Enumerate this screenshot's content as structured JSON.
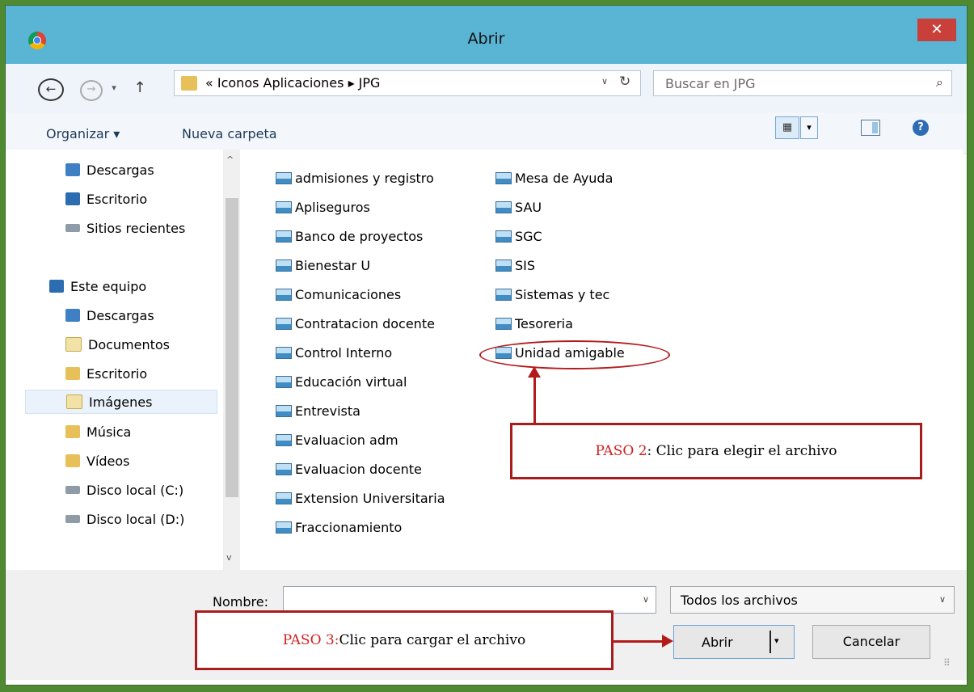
{
  "window": {
    "title": "Abrir",
    "close_label": "✕"
  },
  "nav": {
    "back": "←",
    "forward": "→",
    "history": "▾",
    "up": "↑"
  },
  "address": {
    "path": "« Iconos Aplicaciones ▸ JPG",
    "dropdown": "∨",
    "refresh": "↻"
  },
  "search": {
    "placeholder": "Buscar en JPG",
    "icon": "⌕"
  },
  "toolbar": {
    "organize": "Organizar ▾",
    "new_folder": "Nueva carpeta",
    "view_icon": "▦",
    "view_dropdown": "▾",
    "help": "?"
  },
  "sidebar": {
    "items": [
      {
        "label": "Descargas",
        "icon": "downloads-folder-icon"
      },
      {
        "label": "Escritorio",
        "icon": "desktop-icon"
      },
      {
        "label": "Sitios recientes",
        "icon": "recent-places-icon"
      },
      {
        "label": "Este equipo",
        "icon": "computer-icon"
      },
      {
        "label": "Descargas",
        "icon": "downloads-folder-icon"
      },
      {
        "label": "Documentos",
        "icon": "documents-folder-icon"
      },
      {
        "label": "Escritorio",
        "icon": "desktop-folder-icon"
      },
      {
        "label": "Imágenes",
        "icon": "pictures-folder-icon",
        "selected": true
      },
      {
        "label": "Música",
        "icon": "music-folder-icon"
      },
      {
        "label": "Vídeos",
        "icon": "videos-folder-icon"
      },
      {
        "label": "Disco local (C:)",
        "icon": "drive-c-icon"
      },
      {
        "label": "Disco local (D:)",
        "icon": "drive-d-icon"
      }
    ],
    "scroll_up": "^",
    "scroll_down": "v"
  },
  "files": {
    "col1": [
      "admisiones y registro",
      "Apliseguros",
      "Banco de proyectos",
      "Bienestar U",
      "Comunicaciones",
      "Contratacion docente",
      "Control Interno",
      "Educación virtual",
      "Entrevista",
      "Evaluacion adm",
      "Evaluacion docente",
      "Extension Universitaria",
      "Fraccionamiento"
    ],
    "col2": [
      "Mesa de Ayuda",
      "SAU",
      "SGC",
      "SIS",
      "Sistemas y tec",
      "Tesoreria",
      "Unidad amigable"
    ]
  },
  "annotations": {
    "step2_prefix": "PASO 2",
    "step2_text": ": Clic para elegir el archivo",
    "step3_prefix": "PASO 3:",
    "step3_text": " Clic para cargar el archivo",
    "accent_color": "#b31b1b"
  },
  "footer": {
    "name_label": "Nombre:",
    "name_value": "",
    "name_dropdown": "∨",
    "filetype": "Todos los archivos",
    "filetype_dropdown": "∨",
    "open_label": "Abrir",
    "open_dropdown": "▾",
    "cancel_label": "Cancelar",
    "grip": "⠿"
  }
}
